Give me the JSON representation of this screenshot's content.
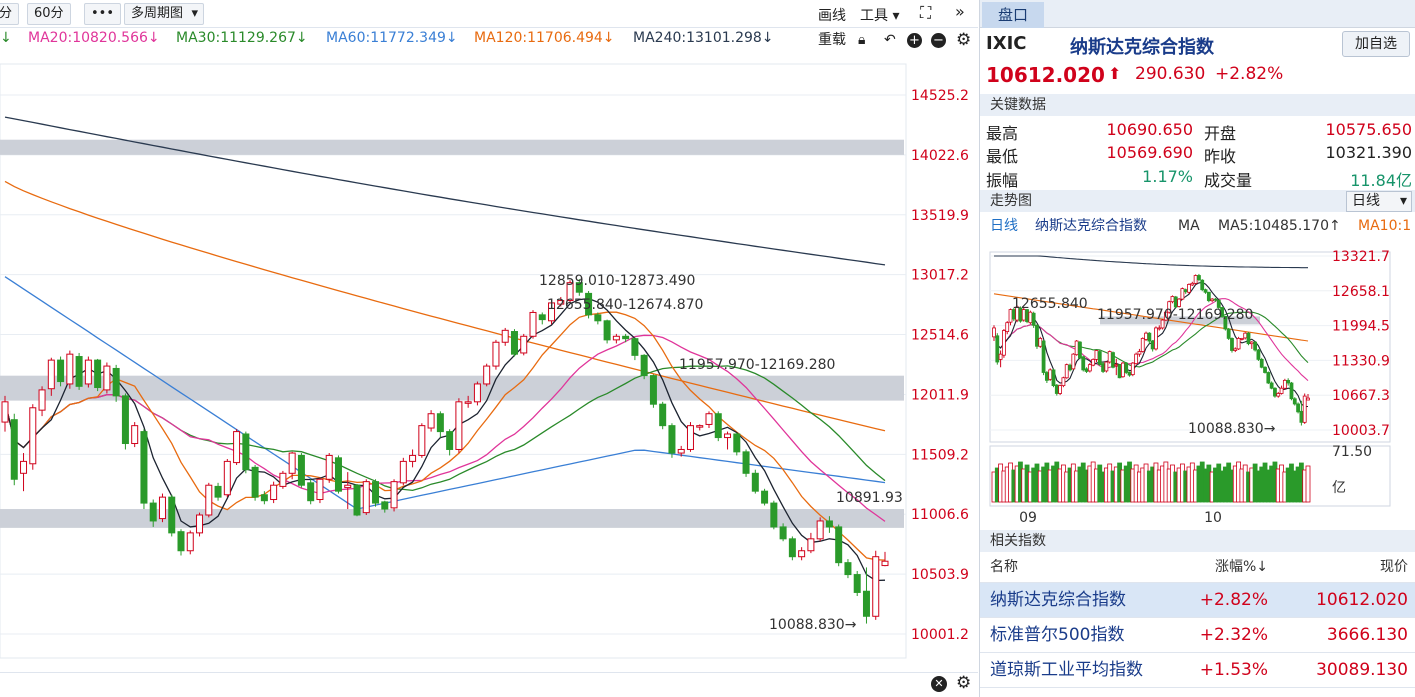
{
  "toolbar": {
    "period_min": "分",
    "period_60": "60分",
    "more": "•••",
    "multi": "多周期图",
    "draw": "画线",
    "tools": "工具",
    "restore": "重载"
  },
  "ma": [
    {
      "label": "MA20:10820.566↓",
      "color": "#e0359a"
    },
    {
      "label": "MA30:11129.267↓",
      "color": "#2a8a2a"
    },
    {
      "label": "MA60:11772.349↓",
      "color": "#3a7fd5"
    },
    {
      "label": "MA120:11706.494↓",
      "color": "#e86b10"
    },
    {
      "label": "MA240:13101.298↓",
      "color": "#2a3a50"
    }
  ],
  "chart_data": {
    "type": "candlestick",
    "y_ticks": [
      14525.2,
      14022.6,
      13519.9,
      13017.2,
      12514.6,
      12011.9,
      11509.2,
      11006.6,
      10503.9,
      10001.2
    ],
    "annotations": [
      "12859.010-12873.490",
      "12655.840-12674.870",
      "11957.970-12169.280",
      "10891.93",
      "10088.830→"
    ],
    "gaps": [
      [
        14022.6,
        14150
      ],
      [
        11960,
        12169.28
      ],
      [
        10891.93,
        11050
      ]
    ],
    "candles": [
      [
        11780,
        11950,
        11700,
        12000
      ],
      [
        11800,
        11300,
        11250,
        11850
      ],
      [
        11350,
        11450,
        11200,
        11520
      ],
      [
        11430,
        11900,
        11380,
        11930
      ],
      [
        11880,
        12050,
        11830,
        12080
      ],
      [
        12060,
        12300,
        12000,
        12320
      ],
      [
        12300,
        12120,
        12080,
        12330
      ],
      [
        12100,
        12350,
        12060,
        12380
      ],
      [
        12330,
        12080,
        12050,
        12360
      ],
      [
        12100,
        12300,
        12070,
        12330
      ],
      [
        12300,
        12070,
        12040,
        12310
      ],
      [
        12050,
        12250,
        12020,
        12280
      ],
      [
        12230,
        12000,
        11950,
        12260
      ],
      [
        12000,
        11600,
        11550,
        12020
      ],
      [
        11600,
        11750,
        11570,
        11780
      ],
      [
        11700,
        11100,
        11050,
        11720
      ],
      [
        11100,
        10950,
        10900,
        11130
      ],
      [
        10970,
        11150,
        10940,
        11180
      ],
      [
        11150,
        10850,
        10820,
        11170
      ],
      [
        10860,
        10700,
        10660,
        10880
      ],
      [
        10700,
        10850,
        10670,
        10870
      ],
      [
        10850,
        11000,
        10820,
        11020
      ],
      [
        11000,
        11250,
        10980,
        11270
      ],
      [
        11240,
        11150,
        11120,
        11270
      ],
      [
        11170,
        11450,
        11150,
        11470
      ],
      [
        11440,
        11700,
        11420,
        11720
      ],
      [
        11680,
        11380,
        11350,
        11700
      ],
      [
        11400,
        11150,
        11120,
        11420
      ],
      [
        11170,
        11120,
        11090,
        11200
      ],
      [
        11130,
        11250,
        11100,
        11280
      ],
      [
        11240,
        11350,
        11220,
        11370
      ],
      [
        11350,
        11520,
        11300,
        11530
      ],
      [
        11500,
        11250,
        11230,
        11520
      ],
      [
        11270,
        11120,
        11090,
        11300
      ],
      [
        11130,
        11300,
        11100,
        11310
      ],
      [
        11300,
        11500,
        11270,
        11520
      ],
      [
        11480,
        11200,
        11180,
        11500
      ],
      [
        11230,
        11250,
        11050,
        11360
      ],
      [
        11250,
        11000,
        10990,
        11260
      ],
      [
        11020,
        11280,
        11000,
        11300
      ],
      [
        11280,
        11100,
        11070,
        11300
      ],
      [
        11110,
        11050,
        11020,
        11120
      ],
      [
        11060,
        11280,
        11030,
        11300
      ],
      [
        11270,
        11450,
        11250,
        11480
      ],
      [
        11450,
        11500,
        11400,
        11550
      ],
      [
        11500,
        11750,
        11480,
        11770
      ],
      [
        11730,
        11850,
        11700,
        11880
      ],
      [
        11850,
        11700,
        11650,
        11870
      ],
      [
        11700,
        11550,
        11500,
        11720
      ],
      [
        11550,
        11950,
        11520,
        11980
      ],
      [
        11950,
        11950,
        11900,
        12000
      ],
      [
        11950,
        12100,
        11920,
        12120
      ],
      [
        12100,
        12250,
        12080,
        12270
      ],
      [
        12250,
        12450,
        12220,
        12470
      ],
      [
        12450,
        12550,
        12420,
        12570
      ],
      [
        12540,
        12350,
        12330,
        12560
      ],
      [
        12360,
        12500,
        12340,
        12520
      ],
      [
        12500,
        12700,
        12480,
        12720
      ],
      [
        12680,
        12640,
        12600,
        12700
      ],
      [
        12630,
        12780,
        12600,
        12800
      ],
      [
        12770,
        12800,
        12750,
        12830
      ],
      [
        12800,
        12950,
        12780,
        12970
      ],
      [
        12950,
        12870,
        12840,
        12980
      ],
      [
        12860,
        12680,
        12650,
        12880
      ],
      [
        12680,
        12630,
        12600,
        12700
      ],
      [
        12630,
        12470,
        12440,
        12640
      ],
      [
        12470,
        12500,
        12440,
        12520
      ],
      [
        12500,
        12480,
        12450,
        12520
      ],
      [
        12480,
        12340,
        12300,
        12490
      ],
      [
        12340,
        12170,
        12140,
        12350
      ],
      [
        12170,
        11930,
        11900,
        12180
      ],
      [
        11930,
        11750,
        11720,
        11950
      ],
      [
        11750,
        11520,
        11480,
        11770
      ],
      [
        11520,
        11550,
        11490,
        11580
      ],
      [
        11550,
        11750,
        11530,
        11780
      ],
      [
        11740,
        11750,
        11710,
        11760
      ],
      [
        11760,
        11850,
        11730,
        11870
      ],
      [
        11850,
        11650,
        11620,
        11870
      ],
      [
        11650,
        11680,
        11550,
        11700
      ],
      [
        11680,
        11530,
        11500,
        11690
      ],
      [
        11530,
        11350,
        11320,
        11550
      ],
      [
        11350,
        11200,
        11180,
        11380
      ],
      [
        11200,
        11100,
        11080,
        11220
      ],
      [
        11100,
        10900,
        10880,
        11120
      ],
      [
        10900,
        10800,
        10780,
        10930
      ],
      [
        10800,
        10650,
        10620,
        10820
      ],
      [
        10650,
        10700,
        10620,
        10730
      ],
      [
        10700,
        10800,
        10680,
        10850
      ],
      [
        10800,
        10950,
        10780,
        10980
      ],
      [
        10950,
        10900,
        10850,
        10990
      ],
      [
        10900,
        10600,
        10570,
        10920
      ],
      [
        10600,
        10500,
        10470,
        10630
      ],
      [
        10500,
        10350,
        10320,
        10530
      ],
      [
        10360,
        10150,
        10088.83,
        10560
      ],
      [
        10150,
        10650,
        10120,
        10700
      ],
      [
        10575.65,
        10612.02,
        10569.69,
        10690.65
      ]
    ]
  },
  "price_labels": {
    "p1": "12859.010-12873.490",
    "p2": "12655.840-12674.870",
    "p3": "11957.970-12169.280",
    "p4": "10891.93",
    "p5": "10088.830→"
  },
  "panel": {
    "tab": "盘口",
    "code": "IXIC",
    "name": "纳斯达克综合指数",
    "watch_btn": "加自选",
    "price": "10612.020",
    "arrow": "⬆",
    "change": "290.630",
    "pct": "+2.82%",
    "key_title": "关键数据",
    "hi_label": "最高",
    "hi": "10690.650",
    "open_label": "开盘",
    "open": "10575.650",
    "lo_label": "最低",
    "lo": "10569.690",
    "prev_label": "昨收",
    "prev": "10321.390",
    "amp_label": "振幅",
    "amp": "1.17%",
    "vol_label": "成交量",
    "vol": "11.84亿",
    "trend_title": "走势图",
    "period": "日线",
    "legend": {
      "daily": "日线",
      "name": "纳斯达克综合指数",
      "ma": "MA",
      "ma5": "MA5:10485.170↑",
      "ma10": "MA10:1"
    },
    "mini_ticks": [
      "13321.7",
      "12658.1",
      "11994.5",
      "11330.9",
      "10667.3",
      "10003.7"
    ],
    "mini_labels": {
      "a": "12655.840",
      "b": "11957.970-12169.280",
      "c": "10088.830→"
    },
    "vol_tick": "71.50",
    "vol_unit": "亿",
    "months": [
      "09",
      "10"
    ],
    "related_title": "相关指数",
    "related_head": {
      "name": "名称",
      "pct": "涨幅%↓",
      "price": "现价"
    },
    "related": [
      {
        "name": "纳斯达克综合指数",
        "pct": "+2.82%",
        "price": "10612.020"
      },
      {
        "name": "标准普尔500指数",
        "pct": "+2.32%",
        "price": "3666.130"
      },
      {
        "name": "道琼斯工业平均指数",
        "pct": "+1.53%",
        "price": "30089.130"
      }
    ]
  }
}
